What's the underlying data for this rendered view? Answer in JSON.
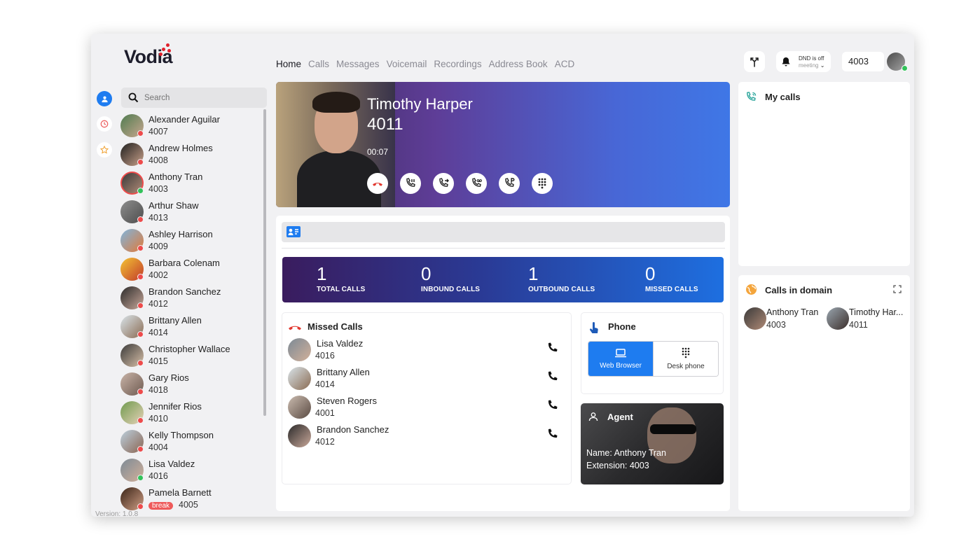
{
  "brand": {
    "name": "Vodia"
  },
  "nav": {
    "items": [
      {
        "label": "Home",
        "active": true
      },
      {
        "label": "Calls",
        "active": false
      },
      {
        "label": "Messages",
        "active": false
      },
      {
        "label": "Voicemail",
        "active": false
      },
      {
        "label": "Recordings",
        "active": false
      },
      {
        "label": "Address Book",
        "active": false
      },
      {
        "label": "ACD",
        "active": false
      }
    ]
  },
  "header": {
    "dnd_status": "DND is off",
    "dnd_mode": "meeting",
    "extension": "4003"
  },
  "search": {
    "placeholder": "Search"
  },
  "contacts": [
    {
      "name": "Alexander Aguilar",
      "ext": "4007",
      "status": "busy"
    },
    {
      "name": "Andrew Holmes",
      "ext": "4008",
      "status": "busy"
    },
    {
      "name": "Anthony Tran",
      "ext": "4003",
      "status": "online"
    },
    {
      "name": "Arthur Shaw",
      "ext": "4013",
      "status": "busy"
    },
    {
      "name": "Ashley Harrison",
      "ext": "4009",
      "status": "busy"
    },
    {
      "name": "Barbara Colenam",
      "ext": "4002",
      "status": "busy"
    },
    {
      "name": "Brandon Sanchez",
      "ext": "4012",
      "status": "busy"
    },
    {
      "name": "Brittany Allen",
      "ext": "4014",
      "status": "busy"
    },
    {
      "name": "Christopher Wallace",
      "ext": "4015",
      "status": "busy"
    },
    {
      "name": "Gary Rios",
      "ext": "4018",
      "status": "busy"
    },
    {
      "name": "Jennifer Rios",
      "ext": "4010",
      "status": "busy"
    },
    {
      "name": "Kelly Thompson",
      "ext": "4004",
      "status": "busy"
    },
    {
      "name": "Lisa Valdez",
      "ext": "4016",
      "status": "online"
    },
    {
      "name": "Pamela Barnett",
      "ext": "4005",
      "status": "busy",
      "badge": "break"
    }
  ],
  "version": "Version: 1.0.8",
  "active_call": {
    "name": "Timothy Harper",
    "ext": "4011",
    "duration": "00:07",
    "actions": [
      "hangup-icon",
      "hold-icon",
      "transfer-icon",
      "voicemail-transfer-icon",
      "park-icon",
      "dialpad-icon"
    ]
  },
  "stats": [
    {
      "value": "1",
      "label": "TOTAL CALLS"
    },
    {
      "value": "0",
      "label": "INBOUND CALLS"
    },
    {
      "value": "1",
      "label": "OUTBOUND CALLS"
    },
    {
      "value": "0",
      "label": "MISSED CALLS"
    }
  ],
  "missed_calls": {
    "title": "Missed Calls",
    "items": [
      {
        "name": "Lisa Valdez",
        "ext": "4016"
      },
      {
        "name": "Brittany Allen",
        "ext": "4014"
      },
      {
        "name": "Steven Rogers",
        "ext": "4001"
      },
      {
        "name": "Brandon Sanchez",
        "ext": "4012"
      }
    ]
  },
  "phone": {
    "title": "Phone",
    "options": [
      {
        "label": "Web Browser",
        "selected": true
      },
      {
        "label": "Desk phone",
        "selected": false
      }
    ]
  },
  "agent": {
    "title": "Agent",
    "name_line": "Name: Anthony Tran",
    "ext_line": "Extension: 4003"
  },
  "my_calls": {
    "title": "My calls"
  },
  "calls_in_domain": {
    "title": "Calls in domain",
    "items": [
      {
        "name": "Anthony Tran",
        "ext": "4003"
      },
      {
        "name": "Timothy Har...",
        "ext": "4011"
      }
    ]
  },
  "colors": {
    "accent": "#1e7cf0",
    "online": "#32c25a",
    "busy": "#ee4b4b",
    "hangup": "#e2382f"
  }
}
